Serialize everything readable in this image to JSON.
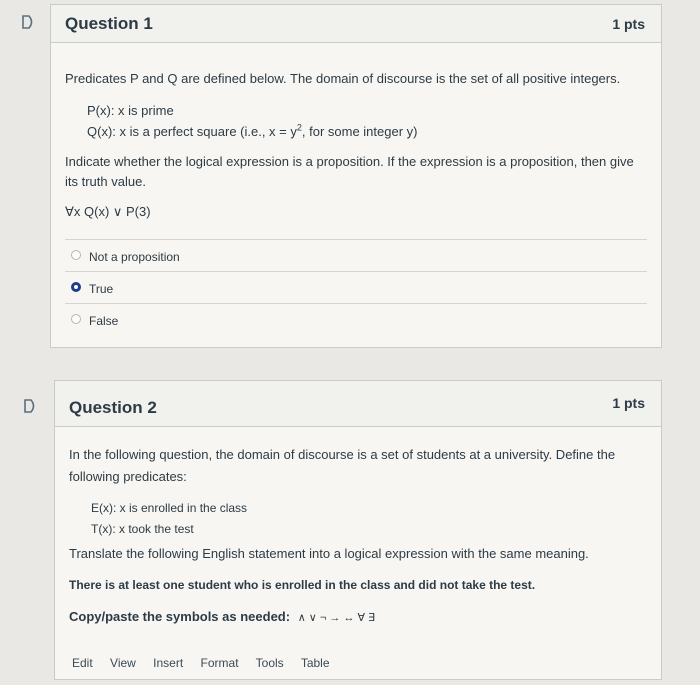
{
  "question1": {
    "title": "Question 1",
    "points": "1 pts",
    "intro": "Predicates P and Q are defined below. The domain of discourse is the set of all positive integers.",
    "def_p": "P(x): x is prime",
    "def_q_before": "Q(x): x is a perfect square (i.e., x = y",
    "def_q_sup": "2",
    "def_q_after": ", for some integer y)",
    "instruction_line1": "Indicate whether the logical expression is a proposition. If the expression is a proposition, then give",
    "instruction_line2": "its truth value.",
    "expression": "∀x Q(x) ∨ P(3)",
    "answers": [
      {
        "label": "Not a proposition",
        "selected": false
      },
      {
        "label": "True",
        "selected": true
      },
      {
        "label": "False",
        "selected": false
      }
    ]
  },
  "question2": {
    "title": "Question 2",
    "points": "1 pts",
    "intro_line1": "In the following question, the domain of discourse is a set of students at a university. Define the",
    "intro_line2": "following predicates:",
    "def_e": "E(x): x is enrolled in the class",
    "def_t": "T(x): x took the test",
    "instruction": "Translate the following English statement into a logical expression with the same meaning.",
    "statement": "There is at least one student who is enrolled in the class and did not take the test.",
    "symbols_label": "Copy/paste the symbols as needed:",
    "symbols": "∧ ∨ ¬ → ↔ ∀ ∃",
    "editor_menu": [
      "Edit",
      "View",
      "Insert",
      "Format",
      "Tools",
      "Table"
    ]
  },
  "colors": {
    "selected_radio": "#1c3c8c",
    "text": "#2d3b45"
  }
}
